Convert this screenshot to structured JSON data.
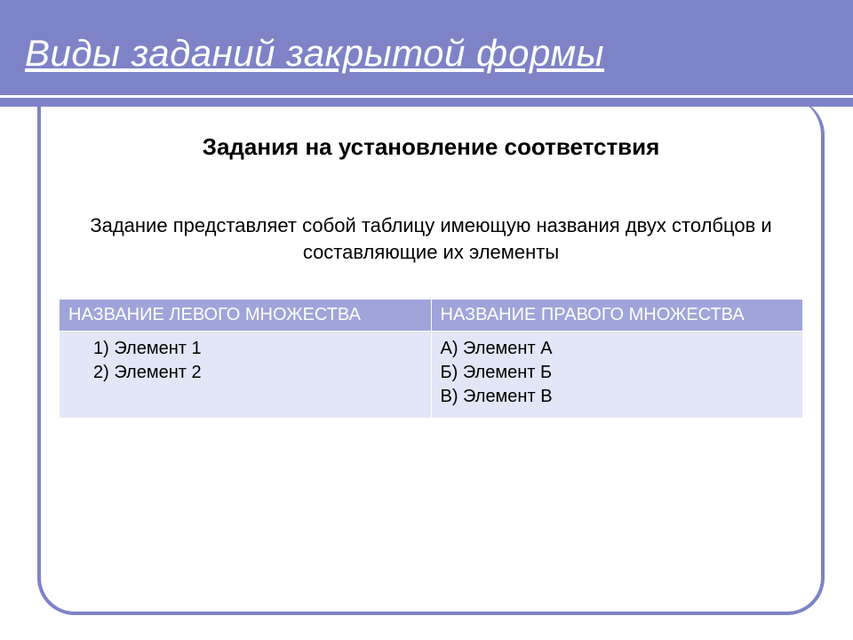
{
  "header": {
    "title": "Виды заданий закрытой формы"
  },
  "content": {
    "subtitle": "Задания на установление соответствия",
    "description": "Задание представляет собой таблицу имеющую названия двух столбцов и составляющие их элементы"
  },
  "table": {
    "headers": {
      "left": "НАЗВАНИЕ ЛЕВОГО МНОЖЕСТВА",
      "right": "НАЗВАНИЕ ПРАВОГО МНОЖЕСТВА"
    },
    "left_items": {
      "0": "1)   Элемент 1",
      "1": "2)   Элемент 2"
    },
    "right_items": {
      "0": "А) Элемент А",
      "1": "Б) Элемент Б",
      "2": "В) Элемент В"
    }
  }
}
